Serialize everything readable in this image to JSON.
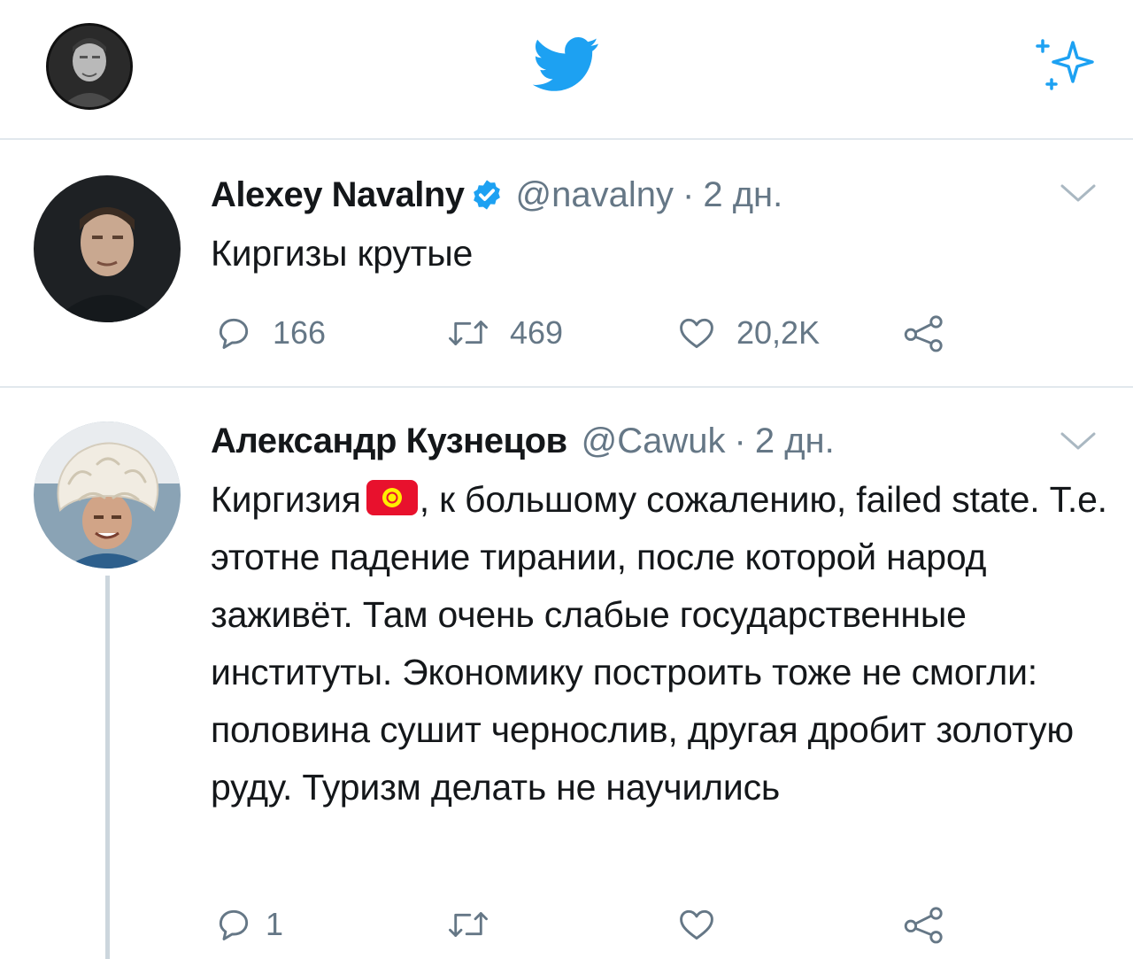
{
  "topbar": {
    "profile_avatar": "user-avatar",
    "logo_icon": "twitter-bird-icon",
    "sparkle_icon": "sparkle-icon"
  },
  "colors": {
    "brand": "#1da1f2",
    "text": "#14171a",
    "muted": "#657786",
    "divider": "#e1e8ed",
    "thread_line": "#ccd6dd",
    "flag_red": "#e8112d",
    "flag_yellow": "#ffef00"
  },
  "tweets": [
    {
      "name": "Alexey Navalny",
      "verified": true,
      "handle": "@navalny",
      "separator": "·",
      "time": "2 дн.",
      "text": "Киргизы крутые",
      "actions": {
        "reply_count": "166",
        "retweet_count": "469",
        "like_count": "20,2K"
      }
    },
    {
      "name": "Александр Кузнецов",
      "verified": false,
      "handle": "@Cawuk",
      "separator": "·",
      "time": "2 дн.",
      "text_before_flag": "Киргизия",
      "flag_icon": "kyrgyzstan-flag-icon",
      "text_after_flag": ", к большому сожалению, failed state. Т.е. этотне падение тирании, после которой народ заживёт. Там очень слабые государственные институты. Экономику построить тоже не смогли: половина сушит чернослив, другая дробит золотую руду. Туризм делать не научились",
      "actions": {
        "reply_count": "1",
        "retweet_count": "",
        "like_count": ""
      }
    }
  ]
}
